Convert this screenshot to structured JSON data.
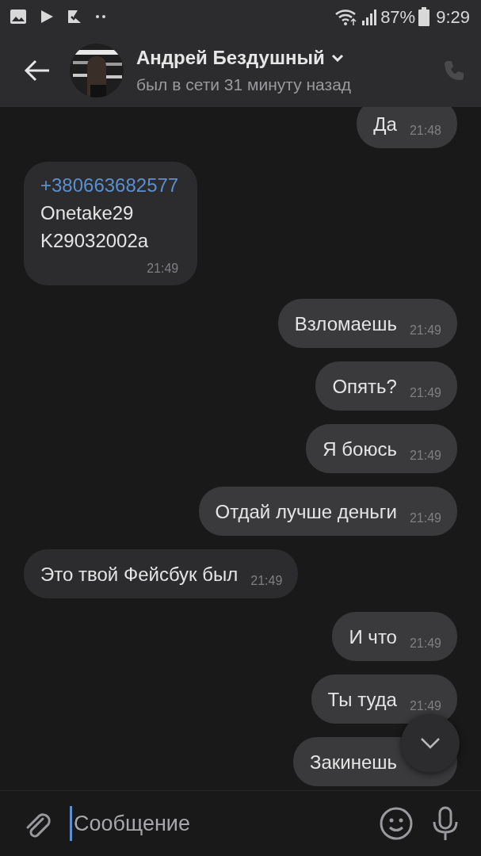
{
  "status_bar": {
    "battery": "87%",
    "time": "9:29"
  },
  "header": {
    "name": "Андрей Бездушный",
    "status": "был в сети 31 минуту назад"
  },
  "messages": [
    {
      "outgoing": true,
      "text": "Да",
      "time": "21:48"
    },
    {
      "outgoing": false,
      "link": "+380663682577",
      "lines": [
        "Onetake29",
        "K29032002a"
      ],
      "time": "21:49"
    },
    {
      "outgoing": true,
      "text": "Взломаешь",
      "time": "21:49"
    },
    {
      "outgoing": true,
      "text": "Опять?",
      "time": "21:49"
    },
    {
      "outgoing": true,
      "text": "Я боюсь",
      "time": "21:49"
    },
    {
      "outgoing": true,
      "text": "Отдай лучше деньги",
      "time": "21:49"
    },
    {
      "outgoing": false,
      "text": "Это твой Фейсбук был",
      "time": "21:49"
    },
    {
      "outgoing": true,
      "text": "И что",
      "time": "21:49"
    },
    {
      "outgoing": true,
      "text": "Ты туда",
      "time": "21:49"
    },
    {
      "outgoing": true,
      "text": "Закинешь"
    }
  ],
  "composer": {
    "placeholder": "Сообщение"
  }
}
